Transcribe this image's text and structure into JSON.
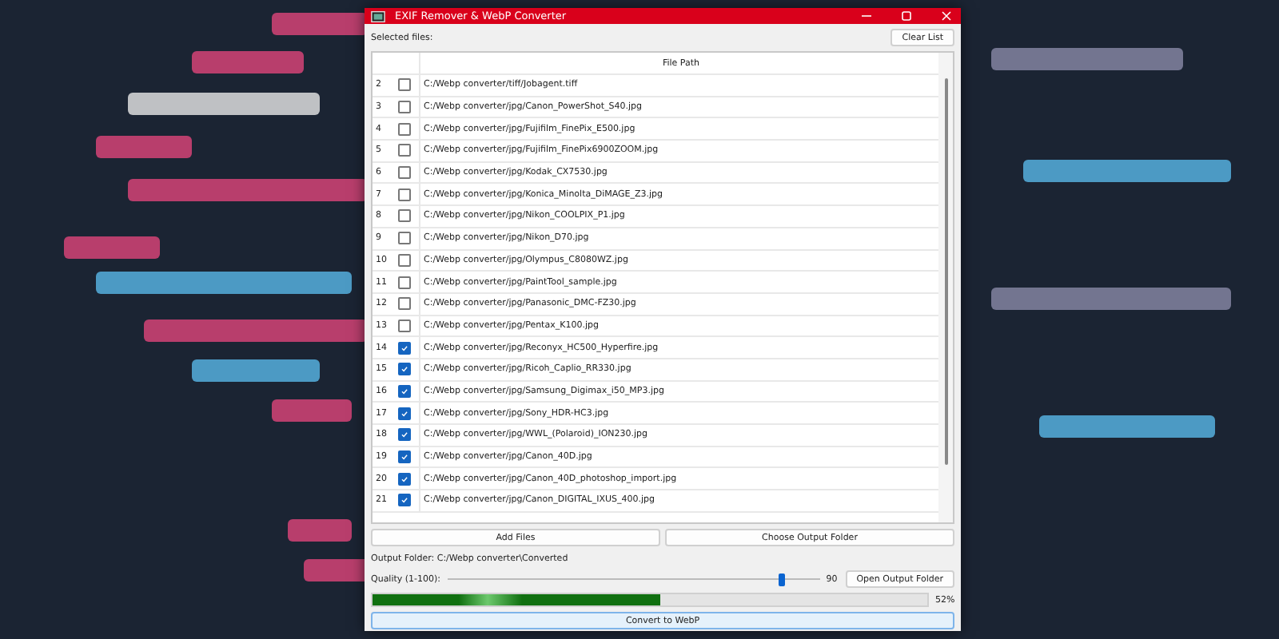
{
  "window": {
    "title": "EXIF Remover & WebP Converter"
  },
  "selected_files_label": "Selected files:",
  "clear_button": "Clear List",
  "table": {
    "columns": [
      "File Path"
    ],
    "rows": [
      {
        "number": "2",
        "checked": false,
        "path": "C:/Webp converter/tiff/Jobagent.tiff"
      },
      {
        "number": "3",
        "checked": false,
        "path": "C:/Webp converter/jpg/Canon_PowerShot_S40.jpg"
      },
      {
        "number": "4",
        "checked": false,
        "path": "C:/Webp converter/jpg/Fujifilm_FinePix_E500.jpg"
      },
      {
        "number": "5",
        "checked": false,
        "path": "C:/Webp converter/jpg/Fujifilm_FinePix6900ZOOM.jpg"
      },
      {
        "number": "6",
        "checked": false,
        "path": "C:/Webp converter/jpg/Kodak_CX7530.jpg"
      },
      {
        "number": "7",
        "checked": false,
        "path": "C:/Webp converter/jpg/Konica_Minolta_DiMAGE_Z3.jpg"
      },
      {
        "number": "8",
        "checked": false,
        "path": "C:/Webp converter/jpg/Nikon_COOLPIX_P1.jpg"
      },
      {
        "number": "9",
        "checked": false,
        "path": "C:/Webp converter/jpg/Nikon_D70.jpg"
      },
      {
        "number": "10",
        "checked": false,
        "path": "C:/Webp converter/jpg/Olympus_C8080WZ.jpg"
      },
      {
        "number": "11",
        "checked": false,
        "path": "C:/Webp converter/jpg/PaintTool_sample.jpg"
      },
      {
        "number": "12",
        "checked": false,
        "path": "C:/Webp converter/jpg/Panasonic_DMC-FZ30.jpg"
      },
      {
        "number": "13",
        "checked": false,
        "path": "C:/Webp converter/jpg/Pentax_K100.jpg"
      },
      {
        "number": "14",
        "checked": true,
        "path": "C:/Webp converter/jpg/Reconyx_HC500_Hyperfire.jpg"
      },
      {
        "number": "15",
        "checked": true,
        "path": "C:/Webp converter/jpg/Ricoh_Caplio_RR330.jpg"
      },
      {
        "number": "16",
        "checked": true,
        "path": "C:/Webp converter/jpg/Samsung_Digimax_i50_MP3.jpg"
      },
      {
        "number": "17",
        "checked": true,
        "path": "C:/Webp converter/jpg/Sony_HDR-HC3.jpg"
      },
      {
        "number": "18",
        "checked": true,
        "path": "C:/Webp converter/jpg/WWL_(Polaroid)_ION230.jpg"
      },
      {
        "number": "19",
        "checked": true,
        "path": "C:/Webp converter/jpg/Canon_40D.jpg"
      },
      {
        "number": "20",
        "checked": true,
        "path": "C:/Webp converter/jpg/Canon_40D_photoshop_import.jpg"
      },
      {
        "number": "21",
        "checked": true,
        "path": "C:/Webp converter/jpg/Canon_DIGITAL_IXUS_400.jpg"
      }
    ]
  },
  "add_files_button": "Add Files",
  "choose_output_button": "Choose Output Folder",
  "output_folder": "Output Folder: C:/Webp converter\\Converted",
  "quality": {
    "label": "Quality (1-100):",
    "level": 0.9,
    "value": "90"
  },
  "open_output_button": "Open Output Folder",
  "progress": {
    "level": 0.52,
    "reading": "52%"
  },
  "convert_button": "Convert to WebP"
}
